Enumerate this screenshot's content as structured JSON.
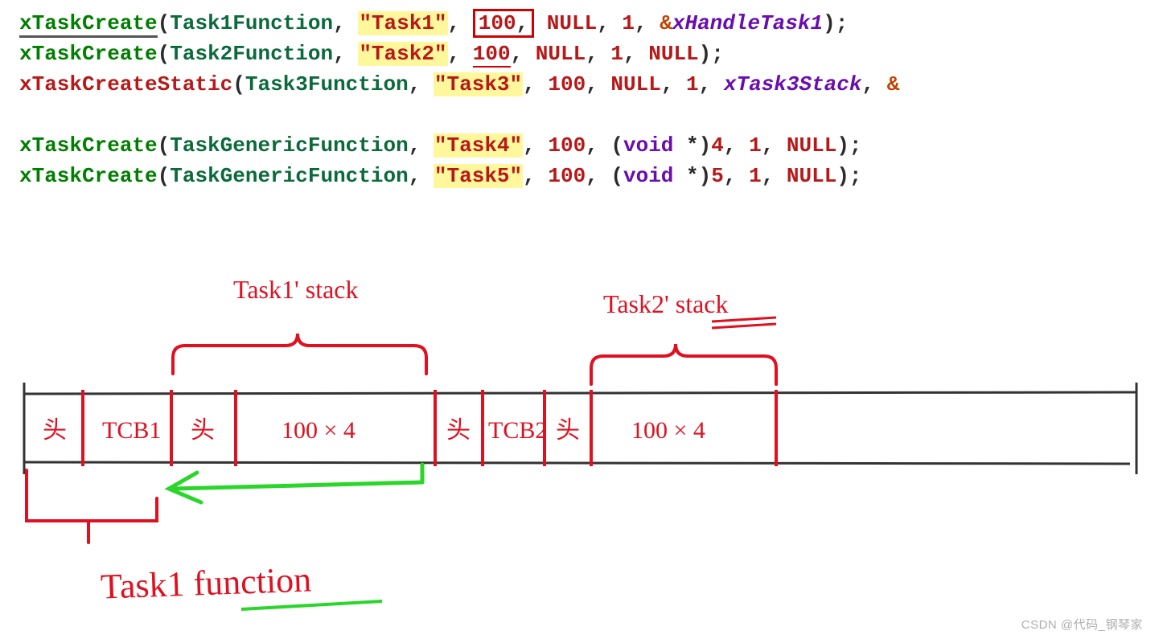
{
  "code": {
    "lines": [
      {
        "func": "xTaskCreate",
        "arg1": "Task1Function",
        "task": "\"Task1\"",
        "size": "100",
        "param": "NULL",
        "prio": "1",
        "last": "&xHandleTask1",
        "boxed": true,
        "handle": true
      },
      {
        "func": "xTaskCreate",
        "arg1": "Task2Function",
        "task": "\"Task2\"",
        "size": "100",
        "param": "NULL",
        "prio": "1",
        "last": "NULL",
        "boxed": false,
        "handle": false
      },
      {
        "func": "xTaskCreateStatic",
        "arg1": "Task3Function",
        "task": "\"Task3\"",
        "size": "100",
        "param": "NULL",
        "prio": "1",
        "stack": "xTask3Stack",
        "tail": "&",
        "static": true
      },
      {
        "gap": true
      },
      {
        "func": "xTaskCreate",
        "arg1": "TaskGenericFunction",
        "task": "\"Task4\"",
        "size": "100",
        "cast": "(void *)",
        "param": "4",
        "prio": "1",
        "last": "NULL"
      },
      {
        "func": "xTaskCreate",
        "arg1": "TaskGenericFunction",
        "task": "\"Task5\"",
        "size": "100",
        "cast": "(void *)",
        "param": "5",
        "prio": "1",
        "last": "NULL"
      }
    ]
  },
  "annotations": {
    "task1stack": "Task1' stack",
    "task2stack": "Task2' stack",
    "task1func": "Task1 function",
    "tcb1": "TCB1",
    "tcb2": "TCB2",
    "size1": "100 × 4",
    "size2": "100 × 4",
    "header_mark": "头",
    "watermark": "CSDN @代码_钢琴家"
  }
}
